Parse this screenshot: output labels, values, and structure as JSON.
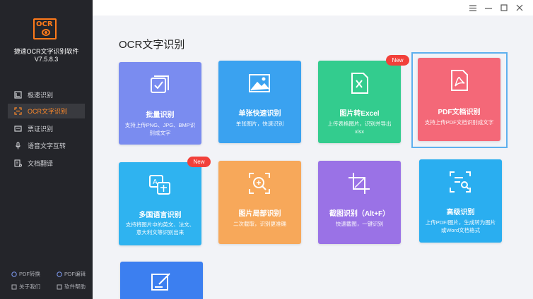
{
  "app": {
    "logo_text": "OCR",
    "name": "捷速OCR文字识别软件",
    "version": "V7.5.8.3"
  },
  "sidebar": {
    "items": [
      {
        "label": "极速识别",
        "icon": "speed-icon"
      },
      {
        "label": "OCR文字识别",
        "icon": "scan-icon",
        "active": true
      },
      {
        "label": "票证识别",
        "icon": "ticket-icon"
      },
      {
        "label": "语音文字互转",
        "icon": "microphone-icon"
      },
      {
        "label": "文档翻译",
        "icon": "translate-icon"
      }
    ],
    "footer": [
      {
        "label": "PDF转换",
        "icon": "pdf-convert-icon"
      },
      {
        "label": "PDF编辑",
        "icon": "pdf-edit-icon"
      },
      {
        "label": "关于我们",
        "icon": "info-icon"
      },
      {
        "label": "软件帮助",
        "icon": "help-icon"
      }
    ]
  },
  "window": {
    "controls": [
      "menu-icon",
      "minimize-icon",
      "maximize-icon",
      "close-icon"
    ]
  },
  "main": {
    "title": "OCR文字识别",
    "badge_new": "New",
    "cards": [
      {
        "title": "批量识别",
        "desc": "支持上传PNG、JPG、BMP识别成文字",
        "icon": "batch-icon",
        "color": "#7a8cf0"
      },
      {
        "title": "单张快速识别",
        "desc": "单张图片，快速识别",
        "icon": "image-icon",
        "color": "#3aa2f0"
      },
      {
        "title": "图片转Excel",
        "desc": "上传表格图片，识别并导出xlsx",
        "icon": "excel-icon",
        "color": "#33cc8e",
        "is_new": true
      },
      {
        "title": "PDF文档识别",
        "desc": "支持上传PDF文档识别成文字",
        "icon": "pdf-icon",
        "color": "#f46878",
        "selected": true
      },
      {
        "title": "多国语言识别",
        "desc": "支持将图片中的英文、法文、意大利文等识别出来",
        "icon": "language-icon",
        "color": "#2fb3f0",
        "is_new": true
      },
      {
        "title": "图片局部识别",
        "desc": "二次截取，识别更准确",
        "icon": "zoom-icon",
        "color": "#f7a85a"
      },
      {
        "title": "截图识别（Alt+F）",
        "desc": "快速截图，一键识别",
        "icon": "crop-icon",
        "color": "#9a72e6"
      },
      {
        "title": "高级识别",
        "desc": "上传PDF/图片，生成转为图片或Word文档格式",
        "icon": "advanced-icon",
        "color": "#2aaef0"
      },
      {
        "title": "",
        "desc": "",
        "icon": "edit-icon",
        "color": "#3c7ff0"
      }
    ]
  }
}
